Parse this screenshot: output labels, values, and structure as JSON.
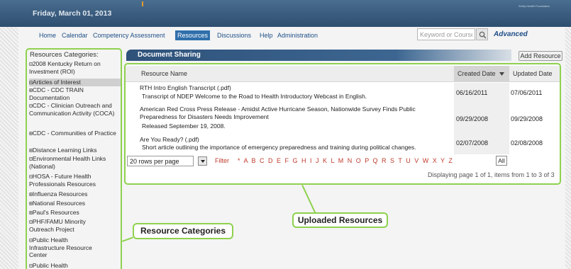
{
  "header": {
    "date": "Friday, March 01, 2013",
    "brand": "Emily Health Foundation"
  },
  "nav": {
    "items": [
      {
        "label": "Home",
        "active": false
      },
      {
        "label": "Calendar",
        "active": false
      },
      {
        "label": "Competency Assessment",
        "active": false
      },
      {
        "label": "Resources",
        "active": true
      },
      {
        "label": "Discussions",
        "active": false
      },
      {
        "label": "Help",
        "active": false
      },
      {
        "label": "Administration",
        "active": false
      }
    ],
    "search_placeholder": "Keyword or Course ID",
    "advanced_label": "Advanced"
  },
  "sidebar": {
    "title": "Resources Categories:",
    "items": [
      {
        "toggle": "⊟",
        "label": "2008 Kentucky Return on Investment (ROI)"
      },
      {
        "toggle": "⊟",
        "label": "Articles of Interest",
        "selected": true
      },
      {
        "toggle": "⊞",
        "label": "CDC - CDC TRAIN Documentation"
      },
      {
        "toggle": "⊟",
        "label": "CDC - Clinician Outreach and Communication Activity (COCA)"
      },
      {
        "toggle": "⊞",
        "label": "CDC - Communities of Practice"
      },
      {
        "toggle": "⊞",
        "label": "Distance Learning Links"
      },
      {
        "toggle": "⊟",
        "label": "Environmental Health Links (National)"
      },
      {
        "toggle": "⊟",
        "label": "HOSA - Future Health Professionals Resources"
      },
      {
        "toggle": "⊞",
        "label": "Influenza Resources"
      },
      {
        "toggle": "⊞",
        "label": "National Resources"
      },
      {
        "toggle": "⊞",
        "label": "Paul's Resources"
      },
      {
        "toggle": "⊟",
        "label": "PHF/FAMU Minority Outreach Project"
      },
      {
        "toggle": "⊟",
        "label": "Public Health Infrastructure Resource Center"
      },
      {
        "toggle": "⊟",
        "label": "Public Health"
      }
    ]
  },
  "document_sharing": {
    "title": "Document Sharing",
    "add_button": "Add Resource",
    "columns": {
      "name": "Resource Name",
      "created": "Created Date",
      "created_sort_icon": "triangle-down",
      "updated": "Updated Date"
    },
    "rows": [
      {
        "title": "RTH Intro English Transcript  (.pdf)",
        "description": "Transcript of NDEP Welcome to the Road to Health Introductory Webcast in English.",
        "created": "06/16/2011",
        "updated": "07/06/2011"
      },
      {
        "title": "American Red Cross Press Release - Amidst Active Hurricane Season, Nationwide Survey Finds Public Preparedness for Disasters Needs Improvement",
        "description": "Released September 19, 2008.",
        "created": "09/29/2008",
        "updated": "09/29/2008"
      },
      {
        "title": "Are You Ready?  (.pdf)",
        "description": "Short article outlining the importance of emergency preparedness and training during political changes.",
        "created": "02/07/2008",
        "updated": "02/08/2008"
      }
    ],
    "rows_per_page": "20 rows per page",
    "filter_label": "Filter",
    "filter_letters": "* A B C D E F G H I J K L M N O P Q R S T U V W X Y Z",
    "all_label": "All",
    "paging_text": "Displaying page 1 of 1, items from 1 to 3 of 3"
  },
  "callouts": {
    "uploaded": "Uploaded Resources",
    "categories": "Resource Categories"
  },
  "colors": {
    "banner": "#3a5c7e",
    "nav_link": "#1e4e87",
    "active_tab": "#2f6fab",
    "callout_border": "#8fd14f",
    "filter_red": "#c0392b"
  }
}
